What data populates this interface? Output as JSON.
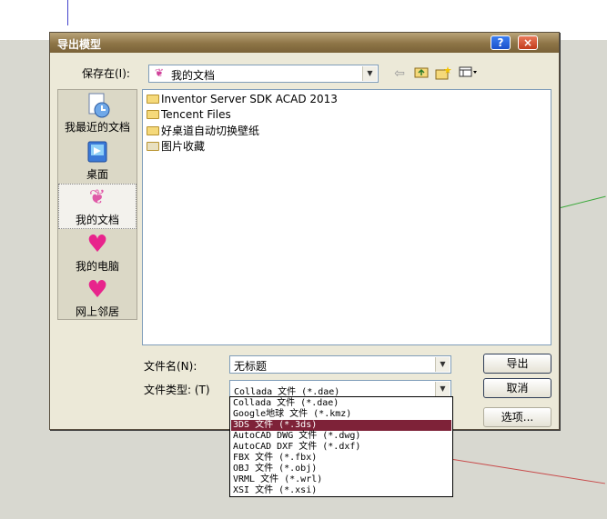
{
  "dialog": {
    "title": "导出模型",
    "help_label": "?",
    "close_label": "×"
  },
  "location": {
    "label": "保存在(I):",
    "value": "我的文档"
  },
  "toolbar": {
    "back_icon": "back-arrow-icon",
    "up_icon": "up-folder-icon",
    "new_folder_icon": "new-folder-icon",
    "view_icon": "view-menu-icon"
  },
  "places": [
    {
      "label": "我最近的文档",
      "icon": "recent-documents-icon"
    },
    {
      "label": "桌面",
      "icon": "desktop-icon"
    },
    {
      "label": "我的文档",
      "icon": "my-documents-icon"
    },
    {
      "label": "我的电脑",
      "icon": "my-computer-icon"
    },
    {
      "label": "网上邻居",
      "icon": "network-places-icon"
    }
  ],
  "files": [
    {
      "name": "Inventor Server SDK ACAD 2013"
    },
    {
      "name": "Tencent Files"
    },
    {
      "name": "好桌道自动切换壁纸"
    },
    {
      "name": "图片收藏"
    }
  ],
  "filename": {
    "label": "文件名(N):",
    "value": "无标题"
  },
  "filetype": {
    "label": "文件类型: (T)",
    "value": "Collada 文件 (*.dae)",
    "options": [
      "Collada 文件 (*.dae)",
      "Google地球 文件 (*.kmz)",
      "3DS 文件 (*.3ds)",
      "AutoCAD DWG 文件 (*.dwg)",
      "AutoCAD DXF 文件 (*.dxf)",
      "FBX 文件 (*.fbx)",
      "OBJ 文件 (*.obj)",
      "VRML 文件 (*.wrl)",
      "XSI 文件 (*.xsi)"
    ],
    "highlighted_option": "3DS 文件 (*.3ds)"
  },
  "buttons": {
    "export": "导出",
    "cancel": "取消",
    "options": "选项..."
  },
  "colors": {
    "title_bar": "#8d7446",
    "dialog_bg": "#ece9d8",
    "highlight": "#7e2238"
  }
}
